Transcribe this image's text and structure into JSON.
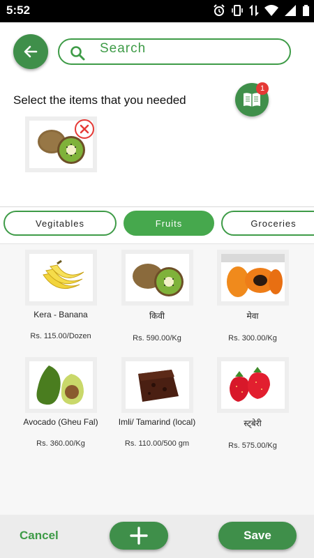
{
  "status_bar": {
    "time": "5:52"
  },
  "search": {
    "placeholder": "Search"
  },
  "prompt": "Select the items that you needed",
  "book_badge": "1",
  "tabs": [
    {
      "label": "Vegitables"
    },
    {
      "label": "Fruits",
      "active": true
    },
    {
      "label": "Groceries"
    }
  ],
  "products": [
    {
      "name": "Kera - Banana",
      "price": "Rs. 115.00/Dozen",
      "icon": "banana-icon"
    },
    {
      "name": "किवी",
      "price": "Rs. 590.00/Kg",
      "icon": "kiwi-icon"
    },
    {
      "name": "मेवा",
      "price": "Rs. 300.00/Kg",
      "icon": "papaya-icon"
    },
    {
      "name": "Avocado (Gheu Fal)",
      "price": "Rs. 360.00/Kg",
      "icon": "avocado-icon"
    },
    {
      "name": "Imli/ Tamarind (local)",
      "price": "Rs. 110.00/500 gm",
      "icon": "tamarind-icon"
    },
    {
      "name": "स्ट्बेरी",
      "price": "Rs. 575.00/Kg",
      "icon": "strawberry-icon"
    }
  ],
  "selected": [
    {
      "icon": "kiwi-icon"
    }
  ],
  "bottom_bar": {
    "cancel_label": "Cancel",
    "save_label": "Save"
  },
  "colors": {
    "primary": "#3f8f4a",
    "accent": "#3e9b47",
    "remove": "#e53935"
  }
}
